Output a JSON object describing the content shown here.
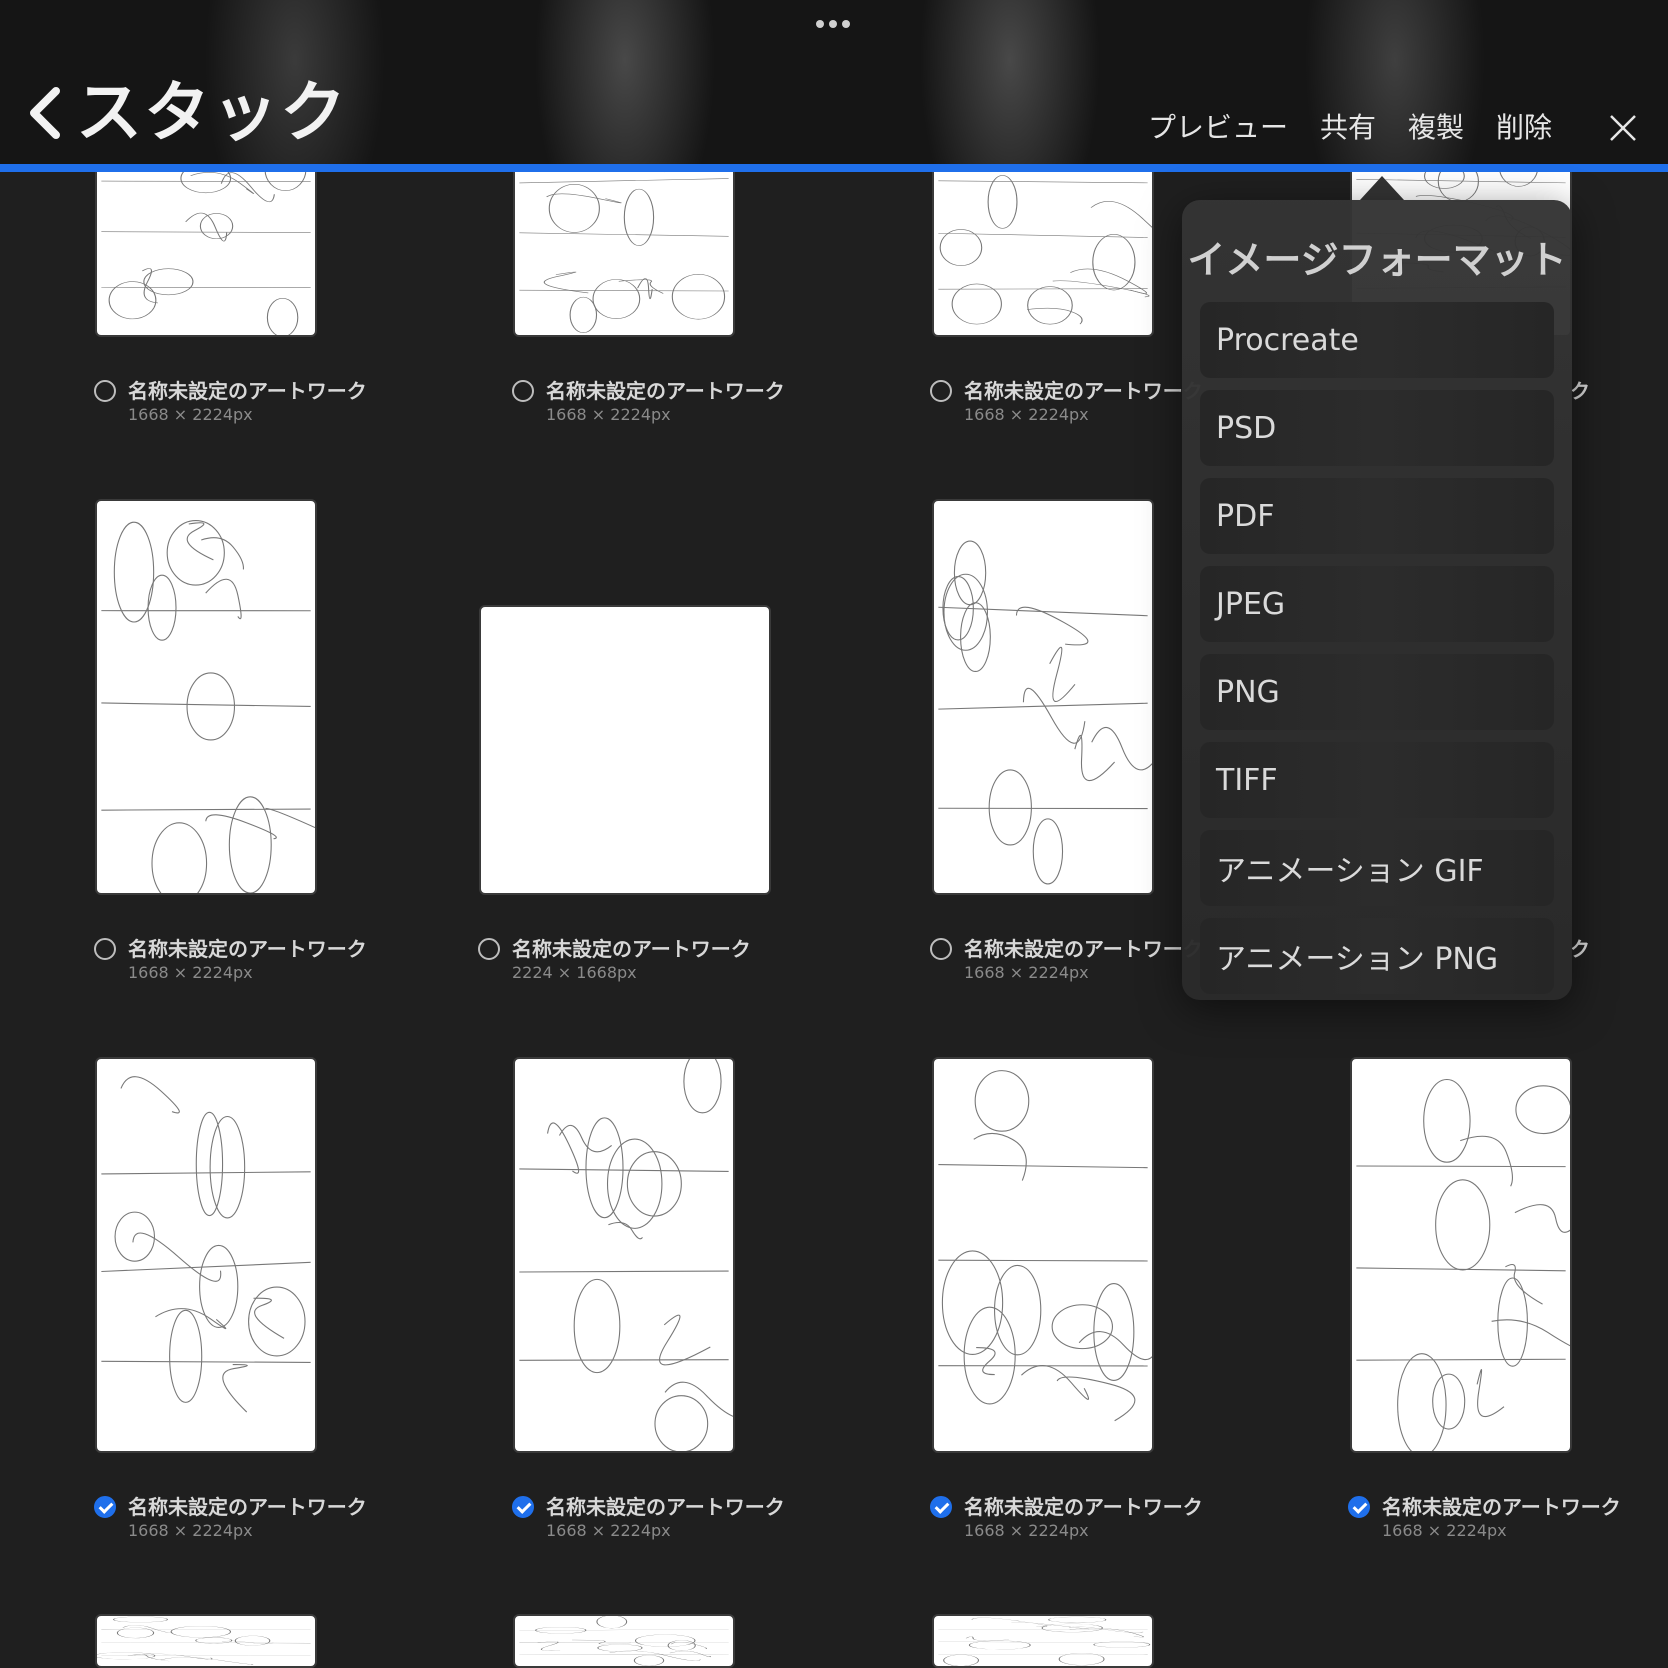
{
  "header": {
    "title": "スタック",
    "actions": [
      "プレビュー",
      "共有",
      "複製",
      "削除"
    ]
  },
  "popover": {
    "title": "イメージフォーマット",
    "items": [
      "Procreate",
      "PSD",
      "PDF",
      "JPEG",
      "PNG",
      "TIFF",
      "アニメーション GIF",
      "アニメーション PNG"
    ]
  },
  "artworks": [
    {
      "title": "名称未設定のアートワーク",
      "size": "1668 × 2224px",
      "selected": false
    },
    {
      "title": "名称未設定のアートワーク",
      "size": "1668 × 2224px",
      "selected": false
    },
    {
      "title": "名称未設定のアートワーク",
      "size": "1668 × 2224px",
      "selected": false
    },
    {
      "title": "ク",
      "size": "",
      "selected": false
    },
    {
      "title": "名称未設定のアートワーク",
      "size": "1668 × 2224px",
      "selected": false
    },
    {
      "title": "名称未設定のアートワーク",
      "size": "2224 × 1668px",
      "selected": false
    },
    {
      "title": "名称未設定のアートワーク",
      "size": "1668 × 2224px",
      "selected": false
    },
    {
      "title": "ク",
      "size": "",
      "selected": false
    },
    {
      "title": "名称未設定のアートワーク",
      "size": "1668 × 2224px",
      "selected": true
    },
    {
      "title": "名称未設定のアートワーク",
      "size": "1668 × 2224px",
      "selected": true
    },
    {
      "title": "名称未設定のアートワーク",
      "size": "1668 × 2224px",
      "selected": true
    },
    {
      "title": "名称未設定のアートワーク",
      "size": "1668 × 2224px",
      "selected": true
    }
  ],
  "colors": {
    "accent": "#1f6feb",
    "background": "#1f1f1f"
  }
}
